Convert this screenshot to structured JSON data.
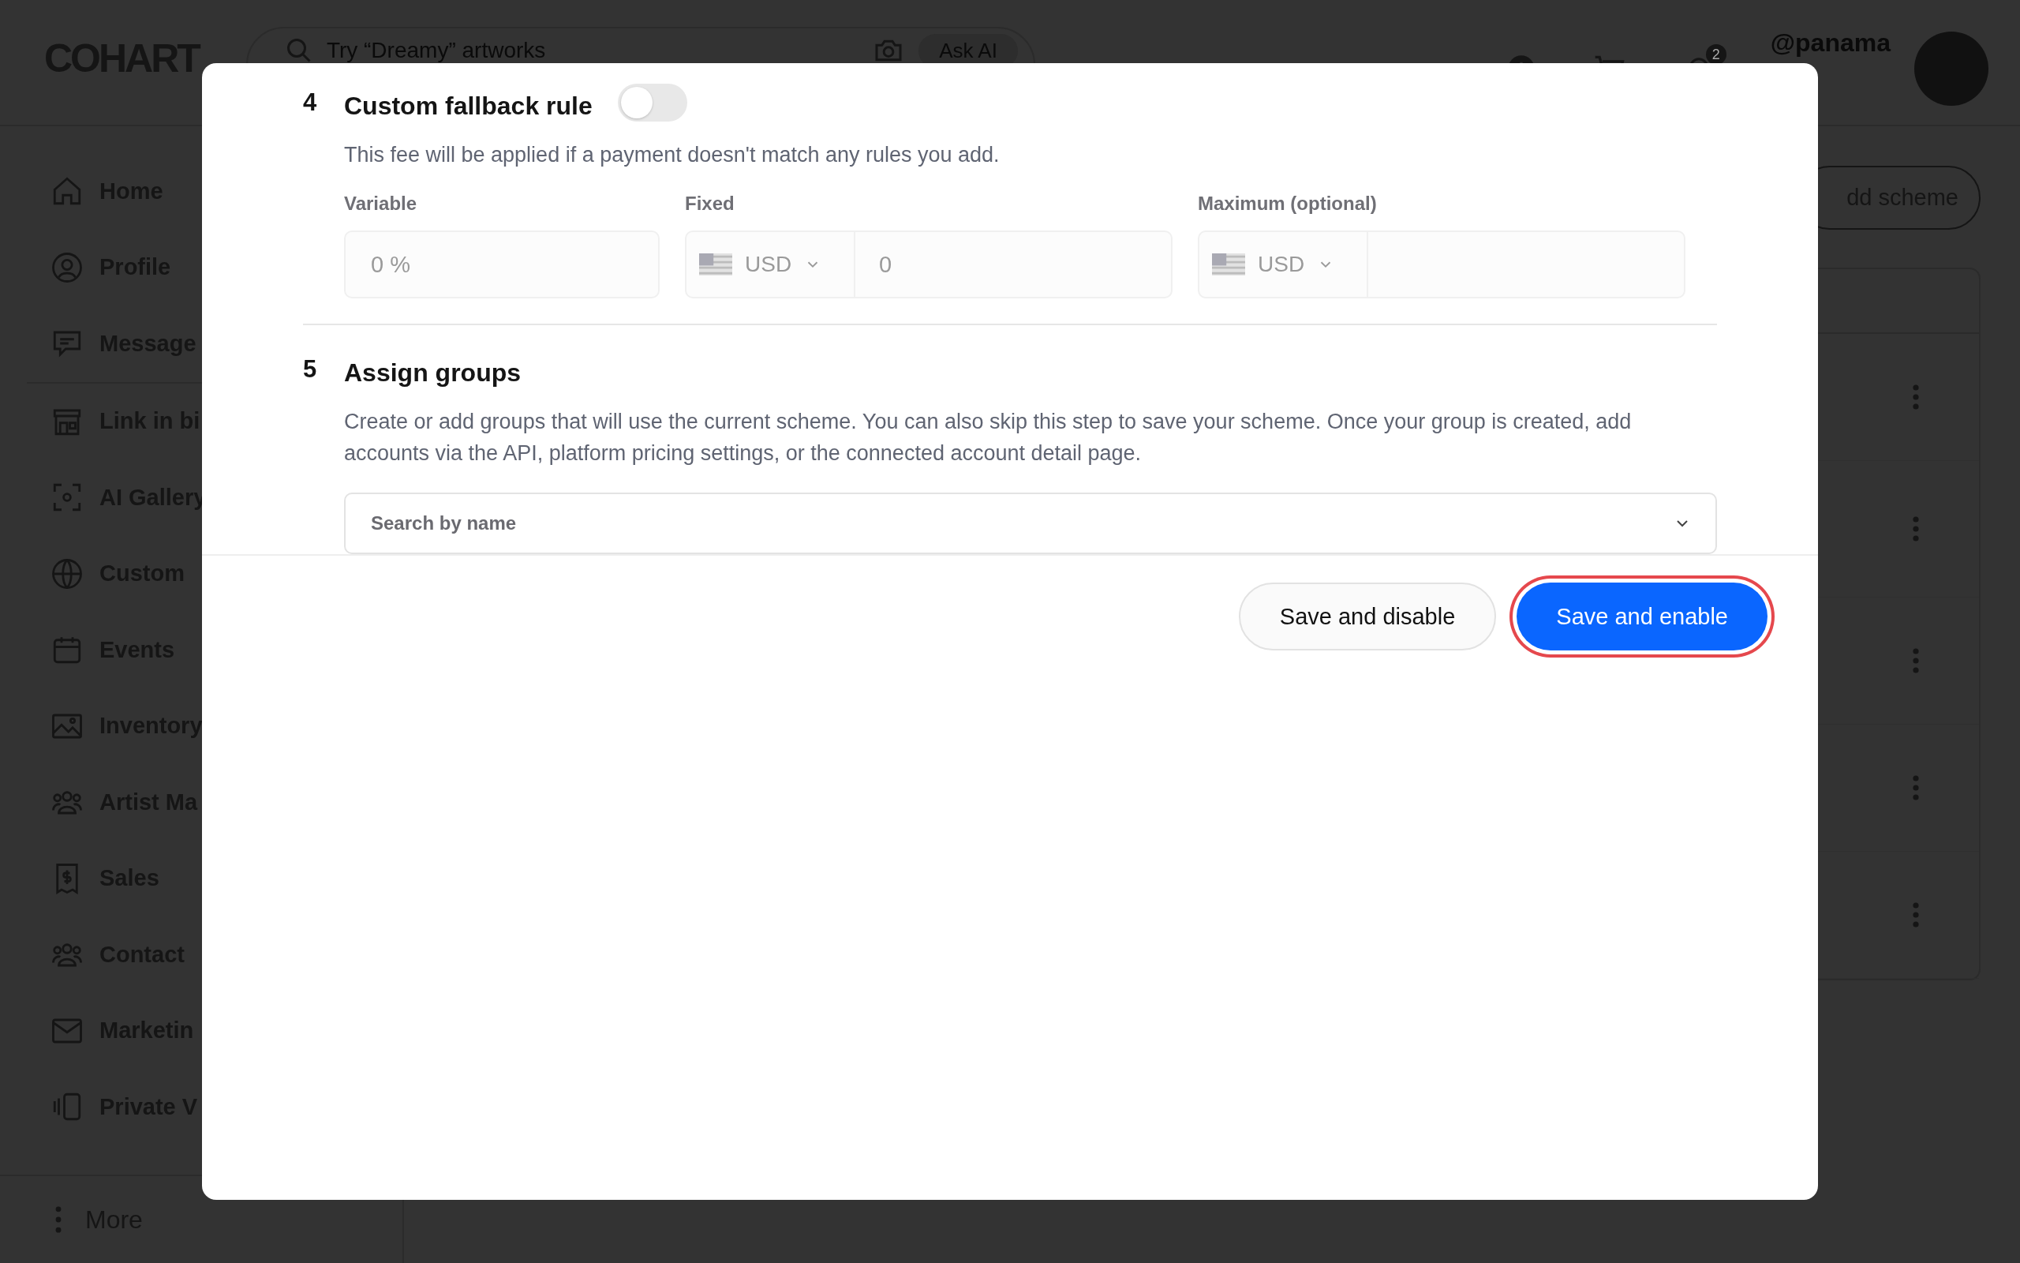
{
  "header": {
    "logo": "COHART",
    "search": {
      "placeholder": "Try “Dreamy” artworks"
    },
    "ask_ai": "Ask AI",
    "notification_count": "2",
    "username": "@panama"
  },
  "sidebar": {
    "items": [
      {
        "label": "Home"
      },
      {
        "label": "Profile"
      },
      {
        "label": "Message"
      },
      {
        "label": "Link in bi"
      },
      {
        "label": "AI Gallery"
      },
      {
        "label": "Custom"
      },
      {
        "label": "Events"
      },
      {
        "label": "Inventory"
      },
      {
        "label": "Artist Ma"
      },
      {
        "label": "Sales"
      },
      {
        "label": "Contact"
      },
      {
        "label": "Marketin"
      },
      {
        "label": "Private V"
      }
    ],
    "more": "More"
  },
  "page": {
    "add_button": "dd scheme"
  },
  "modal": {
    "sections": [
      {
        "number": "4",
        "title": "Custom fallback rule",
        "toggle": {
          "on": false
        },
        "description": "This fee will be applied if a payment doesn't match any rules you add.",
        "fields": [
          {
            "label": "Variable",
            "placeholder": "0 %"
          },
          {
            "label": "Fixed",
            "currency": "USD",
            "placeholder": "0"
          },
          {
            "label": "Maximum (optional)",
            "currency": "USD"
          }
        ]
      },
      {
        "number": "5",
        "title": "Assign groups",
        "description": "Create or add groups that will use the current scheme. You can also skip this step to save your scheme. Once your group is created, add accounts via the API, platform pricing settings, or the connected account detail page.",
        "select": {
          "placeholder": "Search by name"
        }
      }
    ],
    "buttons": [
      {
        "label": "Save and disable",
        "selected": false
      },
      {
        "label": "Save and enable",
        "selected": true
      }
    ]
  }
}
